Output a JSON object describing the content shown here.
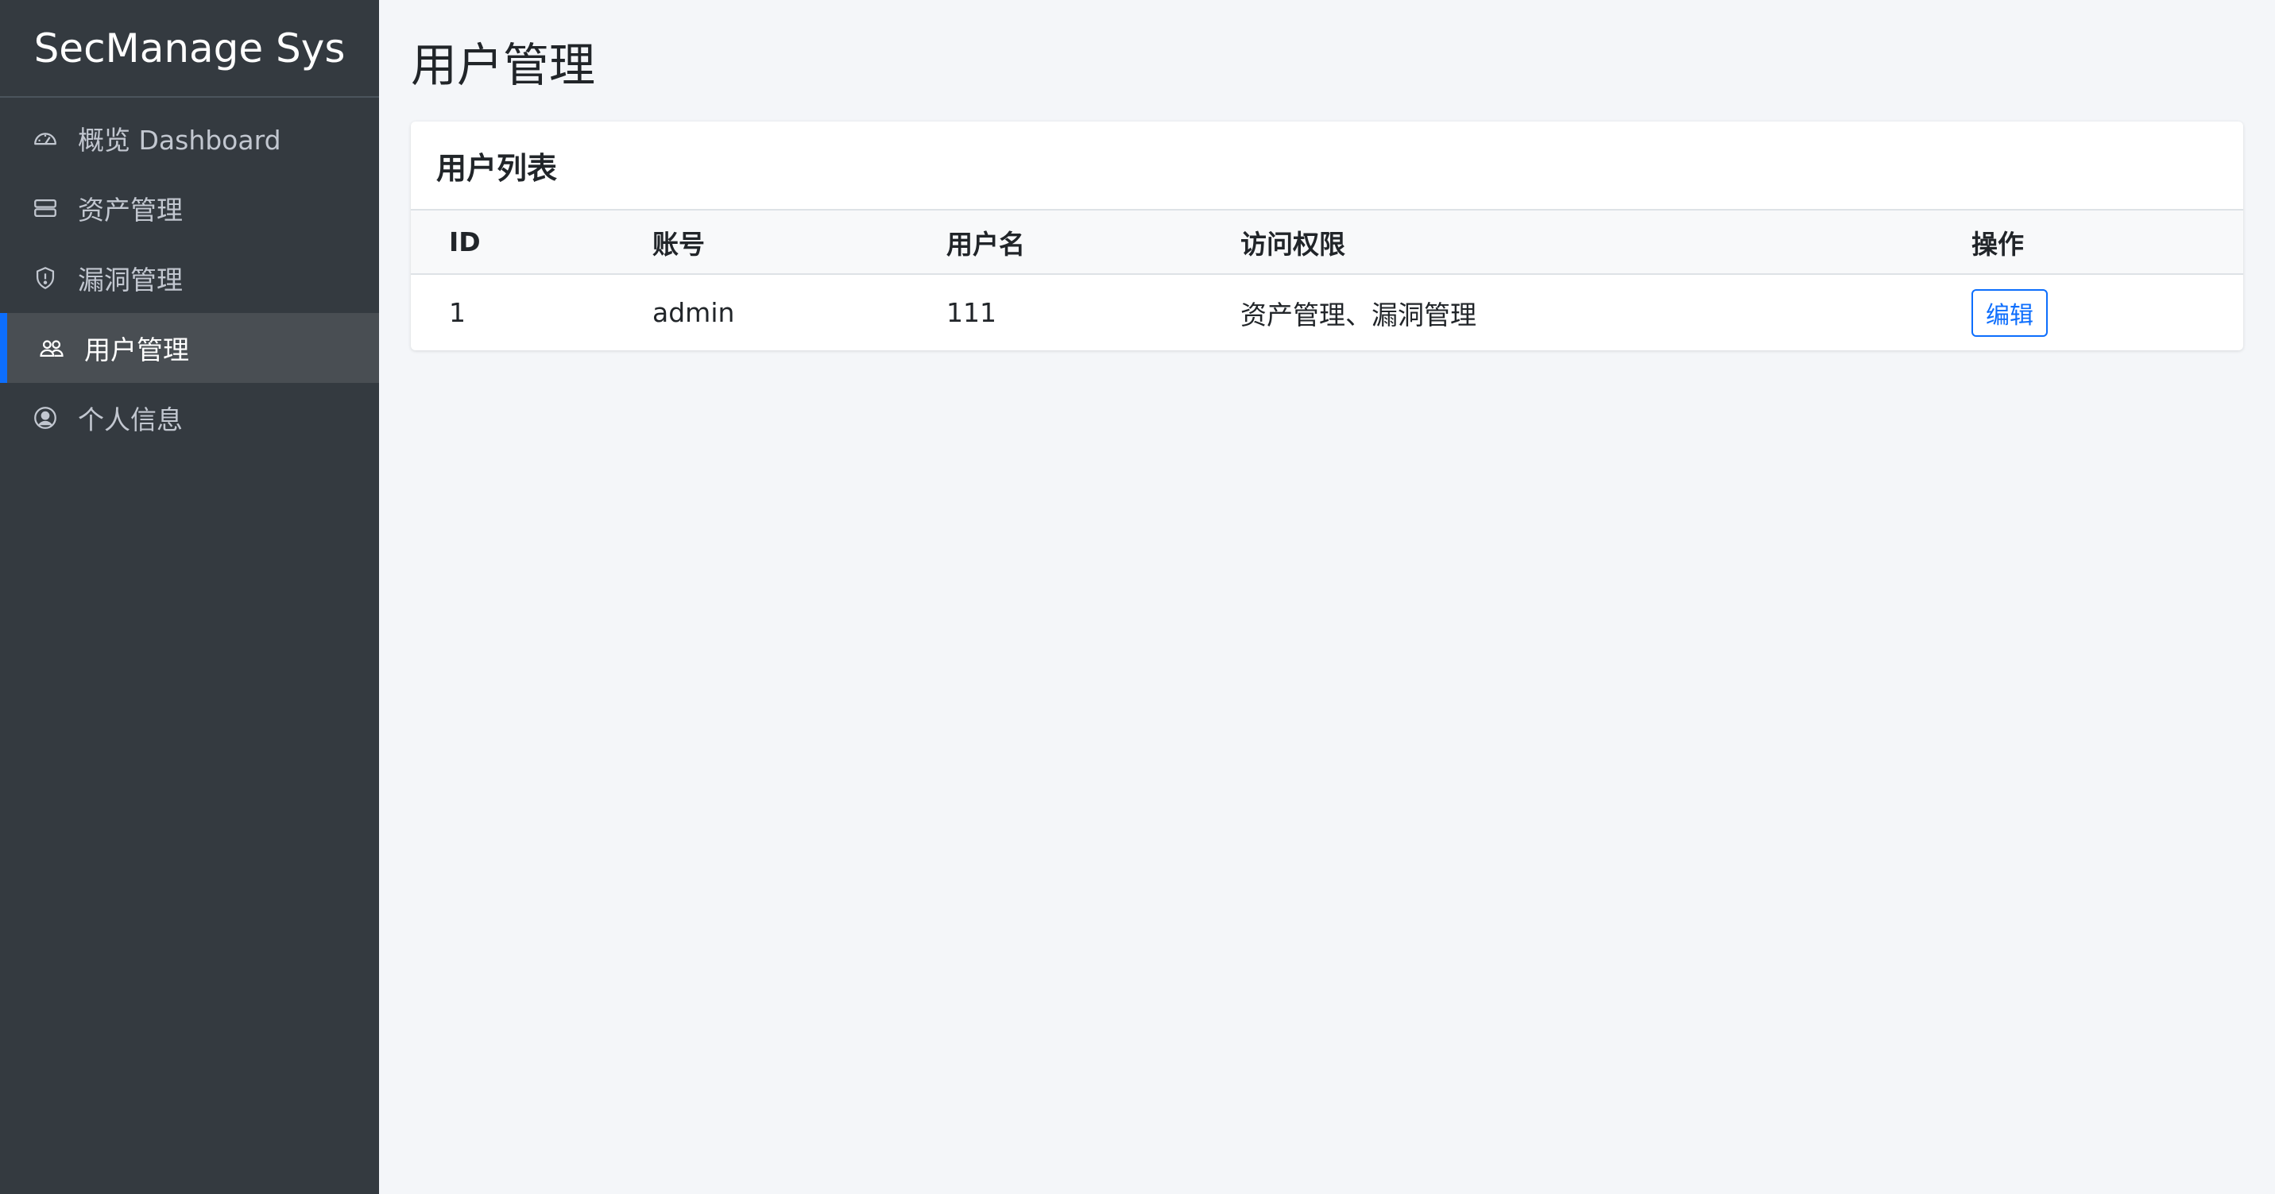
{
  "brand": "SecManage Sys",
  "nav": [
    {
      "label": "概览 Dashboard",
      "icon": "speedometer-icon"
    },
    {
      "label": "资产管理",
      "icon": "server-icon"
    },
    {
      "label": "漏洞管理",
      "icon": "shield-icon"
    },
    {
      "label": "用户管理",
      "icon": "people-icon",
      "active": true
    },
    {
      "label": "个人信息",
      "icon": "person-circle-icon"
    }
  ],
  "page_title": "用户管理",
  "card": {
    "title": "用户列表",
    "columns": [
      "ID",
      "账号",
      "用户名",
      "访问权限",
      "操作"
    ],
    "rows": [
      {
        "id": "1",
        "account": "admin",
        "username": "111",
        "permissions": "资产管理、漏洞管理",
        "action": "编辑"
      }
    ]
  },
  "colors": {
    "sidebar_bg": "#343a40",
    "active_bg": "#494e53",
    "accent": "#0d6efd",
    "page_bg": "#f4f6f9"
  }
}
